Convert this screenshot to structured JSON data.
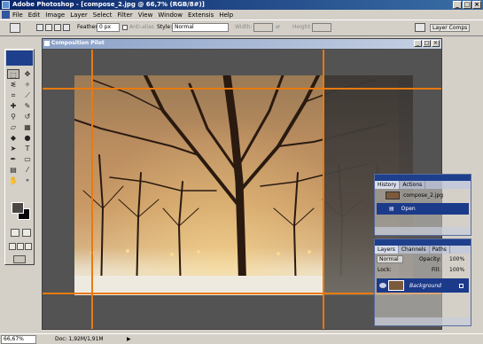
{
  "app": {
    "title": "Adobe Photoshop - [compose_2.jpg @ 66,7% (RGB/8#)]"
  },
  "window_buttons": {
    "minimize": "_",
    "maximize": "□",
    "close": "×"
  },
  "menu": [
    "File",
    "Edit",
    "Image",
    "Layer",
    "Select",
    "Filter",
    "View",
    "Window",
    "Extensis",
    "Help"
  ],
  "options": {
    "feather_label": "Feather:",
    "feather_value": "0 px",
    "antialias_label": "Anti-alias",
    "style_label": "Style:",
    "style_value": "Normal",
    "width_label": "Width:",
    "height_label": "Height:",
    "layer_comps_label": "Layer Comps"
  },
  "document": {
    "title": "Composition Pilot"
  },
  "status": {
    "zoom": "66,67%",
    "doc": "Doc: 1,92M/1,91M",
    "arrow": "▶"
  },
  "history_palette": {
    "tabs": [
      "History",
      "Actions"
    ],
    "items": [
      {
        "label": "compose_2.jpg",
        "type": "snapshot"
      },
      {
        "label": "Open",
        "type": "step",
        "selected": true
      }
    ]
  },
  "layers_palette": {
    "tabs": [
      "Layers",
      "Channels",
      "Paths"
    ],
    "blend_mode": "Normal",
    "opacity_label": "Opacity:",
    "opacity_value": "100%",
    "lock_label": "Lock:",
    "fill_label": "Fill:",
    "fill_value": "100%",
    "layer_name": "Background"
  },
  "colors": {
    "accent": "#0a246a",
    "guide": "#e87a10",
    "selection": "#1c3a8a"
  }
}
